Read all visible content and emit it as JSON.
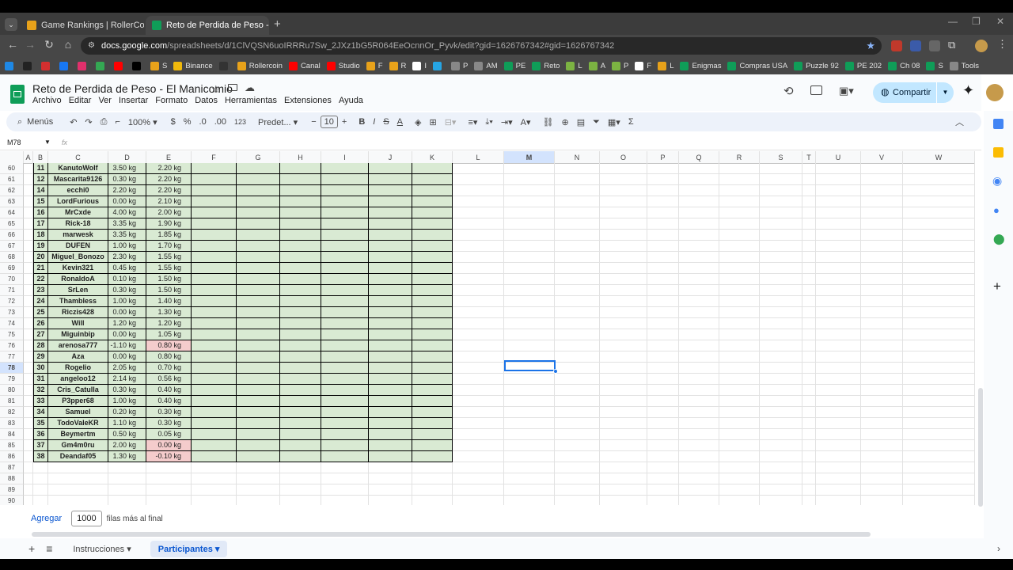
{
  "browser": {
    "tabs": [
      {
        "label": "Game Rankings | RollerCoin.com",
        "icon_color": "#e8a21a"
      },
      {
        "label": "Reto de Perdida de Peso - El M",
        "icon_color": "#0f9d58"
      }
    ],
    "url_domain": "docs.google.com",
    "url_path": "/spreadsheets/d/1ClVQSN6uoIRRRu7Sw_2JXz1bG5R064EeOcnnOr_Pyvk/edit?gid=1626767342#gid=1626767342",
    "bookmarks": [
      {
        "label": "",
        "color": "#1e88e5"
      },
      {
        "label": "",
        "color": "#222"
      },
      {
        "label": "",
        "color": "#d32f2f"
      },
      {
        "label": "",
        "color": "#1877f2"
      },
      {
        "label": "",
        "color": "#e1306c"
      },
      {
        "label": "",
        "color": "#34a853"
      },
      {
        "label": "",
        "color": "#ff0000"
      },
      {
        "label": "",
        "color": "#000"
      },
      {
        "label": "S",
        "color": "#e8a21a"
      },
      {
        "label": "Binance",
        "color": "#f0b90b"
      },
      {
        "label": "",
        "color": "#333"
      },
      {
        "label": "Rollercoin",
        "color": "#e8a21a"
      },
      {
        "label": "Canal",
        "color": "#ff0000"
      },
      {
        "label": "Studio",
        "color": "#ff0000"
      },
      {
        "label": "F",
        "color": "#e8a21a"
      },
      {
        "label": "R",
        "color": "#e8a21a"
      },
      {
        "label": "I",
        "color": "#fff"
      },
      {
        "label": "",
        "color": "#26a5e4"
      },
      {
        "label": "P",
        "color": "#888"
      },
      {
        "label": "AM",
        "color": "#888"
      },
      {
        "label": "PE",
        "color": "#0f9d58"
      },
      {
        "label": "Reto",
        "color": "#0f9d58"
      },
      {
        "label": "L",
        "color": "#7cb342"
      },
      {
        "label": "A",
        "color": "#7cb342"
      },
      {
        "label": "P",
        "color": "#7cb342"
      },
      {
        "label": "F",
        "color": "#fff"
      },
      {
        "label": "L",
        "color": "#e8a21a"
      },
      {
        "label": "Enigmas",
        "color": "#0f9d58"
      },
      {
        "label": "Compras USA",
        "color": "#0f9d58"
      },
      {
        "label": "Puzzle 92",
        "color": "#0f9d58"
      },
      {
        "label": "PE 202",
        "color": "#0f9d58"
      },
      {
        "label": "Ch 08",
        "color": "#0f9d58"
      },
      {
        "label": "S",
        "color": "#0f9d58"
      },
      {
        "label": "Tools",
        "color": "#888"
      }
    ]
  },
  "doc": {
    "title": "Reto de Perdida de Peso - El Manicomio",
    "menus": [
      "Archivo",
      "Editar",
      "Ver",
      "Insertar",
      "Formato",
      "Datos",
      "Herramientas",
      "Extensiones",
      "Ayuda"
    ],
    "share": "Compartir"
  },
  "toolbar": {
    "search": "Menús",
    "zoom": "100%",
    "currency": "$",
    "percent": "%",
    "dec_minus": ".0",
    "dec_plus": ".00",
    "num_format": "123",
    "font": "Predet...",
    "font_size": "10",
    "bold": "B",
    "italic": "I"
  },
  "formula": {
    "namebox": "M78",
    "fx": "fx"
  },
  "columns": [
    "A",
    "B",
    "C",
    "D",
    "E",
    "F",
    "G",
    "H",
    "I",
    "J",
    "K",
    "L",
    "M",
    "N",
    "O",
    "P",
    "Q",
    "R",
    "S",
    "T",
    "U",
    "V",
    "W"
  ],
  "rows": [
    {
      "n": "60",
      "b": "11",
      "c": "KanutoWolf",
      "d": "3.50 kg",
      "e": "2.20 kg",
      "pink": false
    },
    {
      "n": "61",
      "b": "12",
      "c": "Mascarita9126",
      "d": "0.30 kg",
      "e": "2.20 kg",
      "pink": false
    },
    {
      "n": "62",
      "b": "14",
      "c": "ecchi0",
      "d": "2.20 kg",
      "e": "2.20 kg",
      "pink": false
    },
    {
      "n": "63",
      "b": "15",
      "c": "LordFurious",
      "d": "0.00 kg",
      "e": "2.10 kg",
      "pink": false
    },
    {
      "n": "64",
      "b": "16",
      "c": "MrCxde",
      "d": "4.00 kg",
      "e": "2.00 kg",
      "pink": false
    },
    {
      "n": "65",
      "b": "17",
      "c": "Rick-18",
      "d": "3.35 kg",
      "e": "1.90 kg",
      "pink": false
    },
    {
      "n": "66",
      "b": "18",
      "c": "marwesk",
      "d": "3.35 kg",
      "e": "1.85 kg",
      "pink": false
    },
    {
      "n": "67",
      "b": "19",
      "c": "DUFEN",
      "d": "1.00 kg",
      "e": "1.70 kg",
      "pink": false
    },
    {
      "n": "68",
      "b": "20",
      "c": "Miguel_Bonozo",
      "d": "2.30 kg",
      "e": "1.55 kg",
      "pink": false
    },
    {
      "n": "69",
      "b": "21",
      "c": "Kevin321",
      "d": "0.45 kg",
      "e": "1.55 kg",
      "pink": false
    },
    {
      "n": "70",
      "b": "22",
      "c": "RonaldoA",
      "d": "0.10 kg",
      "e": "1.50 kg",
      "pink": false
    },
    {
      "n": "71",
      "b": "23",
      "c": "SrLen",
      "d": "0.30 kg",
      "e": "1.50 kg",
      "pink": false
    },
    {
      "n": "72",
      "b": "24",
      "c": "Thambless",
      "d": "1.00 kg",
      "e": "1.40 kg",
      "pink": false
    },
    {
      "n": "73",
      "b": "25",
      "c": "Riczis428",
      "d": "0.00 kg",
      "e": "1.30 kg",
      "pink": false
    },
    {
      "n": "74",
      "b": "26",
      "c": "Will",
      "d": "1.20 kg",
      "e": "1.20 kg",
      "pink": false
    },
    {
      "n": "75",
      "b": "27",
      "c": "Miguinbip",
      "d": "0.00 kg",
      "e": "1.05 kg",
      "pink": false
    },
    {
      "n": "76",
      "b": "28",
      "c": "arenosa777",
      "d": "-1.10 kg",
      "e": "0.80 kg",
      "pink": true
    },
    {
      "n": "77",
      "b": "29",
      "c": "Aza",
      "d": "0.00 kg",
      "e": "0.80 kg",
      "pink": false
    },
    {
      "n": "78",
      "b": "30",
      "c": "Rogelio",
      "d": "2.05 kg",
      "e": "0.70 kg",
      "pink": false
    },
    {
      "n": "79",
      "b": "31",
      "c": "angeloo12",
      "d": "2.14 kg",
      "e": "0.56 kg",
      "pink": false
    },
    {
      "n": "80",
      "b": "32",
      "c": "Cris_Catulla",
      "d": "0.30 kg",
      "e": "0.40 kg",
      "pink": false
    },
    {
      "n": "81",
      "b": "33",
      "c": "P3pper68",
      "d": "1.00 kg",
      "e": "0.40 kg",
      "pink": false
    },
    {
      "n": "82",
      "b": "34",
      "c": "Samuel",
      "d": "0.20 kg",
      "e": "0.30 kg",
      "pink": false
    },
    {
      "n": "83",
      "b": "35",
      "c": "TodoValeKR",
      "d": "1.10 kg",
      "e": "0.30 kg",
      "pink": false
    },
    {
      "n": "84",
      "b": "36",
      "c": "Beymertm",
      "d": "0.50 kg",
      "e": "0.05 kg",
      "pink": false
    },
    {
      "n": "85",
      "b": "37",
      "c": "Gm4m0ru",
      "d": "2.00 kg",
      "e": "0.00 kg",
      "pink": true
    },
    {
      "n": "86",
      "b": "38",
      "c": "Deandaf05",
      "d": "1.30 kg",
      "e": "-0.10 kg",
      "pink": true
    }
  ],
  "empty_rows": [
    "87",
    "88",
    "89",
    "90"
  ],
  "footer": {
    "add_label": "Agregar",
    "add_count": "1000",
    "add_suffix": "filas más al final"
  },
  "sheets": [
    {
      "label": "Instrucciones",
      "active": false
    },
    {
      "label": "Participantes",
      "active": true
    }
  ]
}
